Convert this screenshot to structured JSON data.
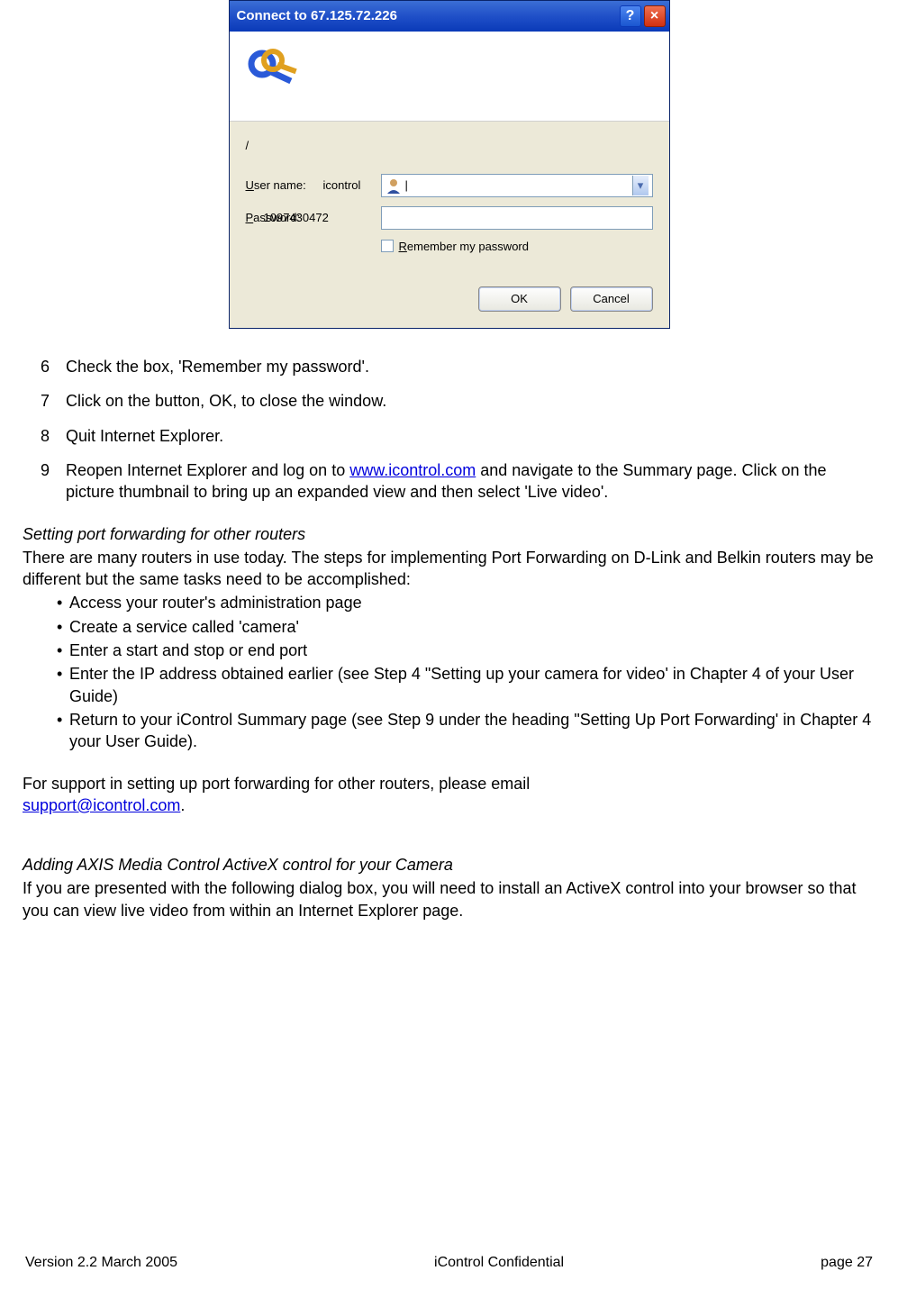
{
  "dialog": {
    "title": "Connect to 67.125.72.226",
    "help_icon": "?",
    "close_icon": "×",
    "realm": "/",
    "username_label_pre": "U",
    "username_label_post": "ser name:",
    "username_overlay": "icontrol",
    "password_label_pre": "P",
    "password_label_post": "assword:",
    "password_overlay": "1097430472",
    "combo_cursor": "|",
    "drop_arrow": "▾",
    "remember_pre": "R",
    "remember_post": "emember my password",
    "ok": "OK",
    "cancel": "Cancel"
  },
  "steps": {
    "s6": {
      "num": "6",
      "text": "Check the box, 'Remember my password'."
    },
    "s7": {
      "num": "7",
      "text": "Click on the button, OK, to close the window."
    },
    "s8": {
      "num": "8",
      "text": "Quit Internet Explorer."
    },
    "s9": {
      "num": "9",
      "text_a": "Reopen Internet Explorer and log on to ",
      "link": "www.icontrol.com",
      "text_b": " and navigate to the Summary page.  Click on the picture thumbnail to bring up an expanded view and then select 'Live video'."
    }
  },
  "section1": {
    "head": "Setting port forwarding for other routers",
    "intro": "There are many routers in use today. The steps for implementing Port Forwarding on D-Link and Belkin routers may be different but the same tasks need to be accomplished:",
    "bul": {
      "b1": "Access your router's administration page",
      "b2": "Create a service called 'camera'",
      "b3": "Enter a start and stop or end port",
      "b4": "Enter the IP address obtained earlier (see Step 4 \"Setting up your camera for video' in Chapter 4 of your User Guide)",
      "b5": "Return to your iControl Summary page (see Step 9 under the heading \"Setting Up Port Forwarding' in Chapter 4 your User Guide)."
    },
    "support_a": "For support in setting up port forwarding for other routers, please email ",
    "support_link": "support@icontrol.com",
    "support_b": "."
  },
  "section2": {
    "head": "Adding AXIS Media Control ActiveX control for your Camera",
    "text": "If you are presented with the following dialog box, you will need to install an ActiveX control into your browser so that you can view live video from within an Internet Explorer page."
  },
  "footer": {
    "left": "Version 2.2 March 2005",
    "mid": "iControl     Confidential",
    "right": "page 27"
  },
  "bullet": "•"
}
